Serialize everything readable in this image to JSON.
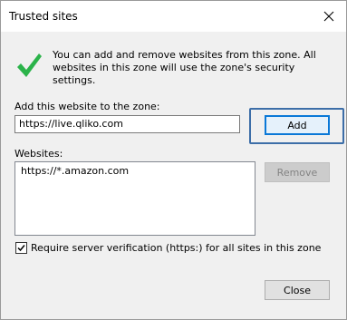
{
  "window": {
    "title": "Trusted sites"
  },
  "info": {
    "text": "You can add and remove websites from this zone. All websites in this zone will use the zone's security settings."
  },
  "add_section": {
    "label": "Add this website to the zone:",
    "input_value": "https://live.qliko.com",
    "add_label": "Add"
  },
  "websites": {
    "label": "Websites:",
    "items": [
      "https://*.amazon.com"
    ],
    "remove_label": "Remove"
  },
  "verification": {
    "label": "Require server verification (https:) for all sites in this zone",
    "checked": true
  },
  "footer": {
    "close_label": "Close"
  },
  "colors": {
    "focus_highlight": "#3d6ea8",
    "check_green": "#2bb34a"
  }
}
